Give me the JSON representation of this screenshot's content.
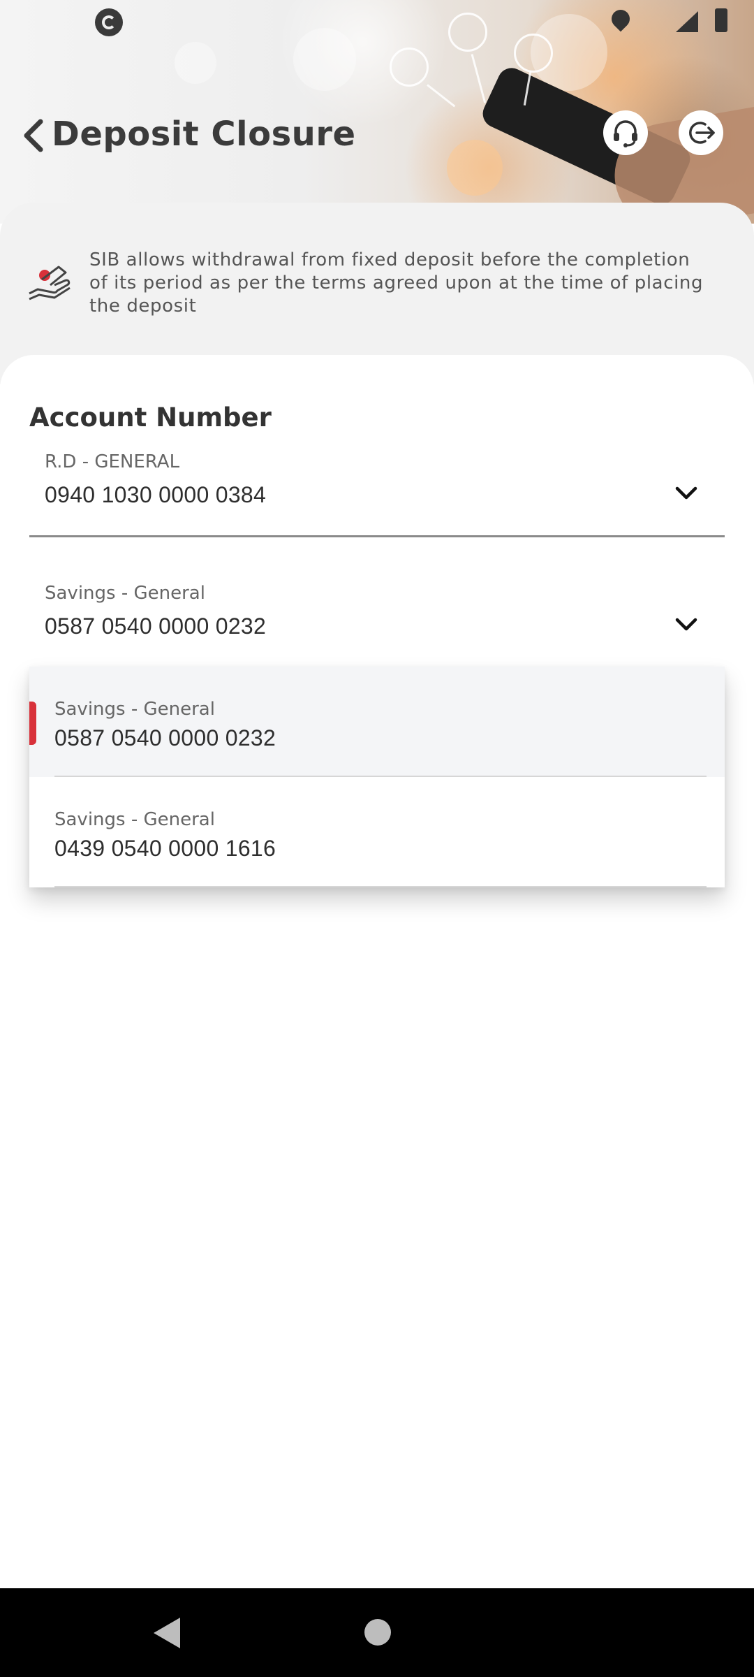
{
  "header": {
    "title": "Deposit Closure"
  },
  "info": {
    "text": "SIB allows withdrawal from fixed deposit before the completion of its period as per the terms agreed upon at the time of placing the deposit"
  },
  "account_section": {
    "label": "Account Number",
    "from_account": {
      "type": "R.D - GENERAL",
      "number": "0940 1030 0000 0384"
    },
    "to_account": {
      "type": "Savings - General",
      "number": "0587 0540 0000 0232"
    }
  },
  "dropdown": {
    "items": [
      {
        "type": "Savings - General",
        "number": "0587 0540 0000 0232",
        "selected": true
      },
      {
        "type": "Savings - General",
        "number": "0439 0540 0000 1616",
        "selected": false
      }
    ]
  },
  "colors": {
    "accent_red": "#d8313a",
    "title_text": "#3b3b3b",
    "nav_bar": "#000000"
  },
  "icons": [
    "app-logo-icon",
    "location-icon",
    "signal-icon",
    "battery-icon",
    "back-chevron-icon",
    "headset-icon",
    "logout-icon",
    "deposit-hand-icon",
    "chevron-down-icon",
    "nav-back-icon",
    "nav-home-icon"
  ]
}
